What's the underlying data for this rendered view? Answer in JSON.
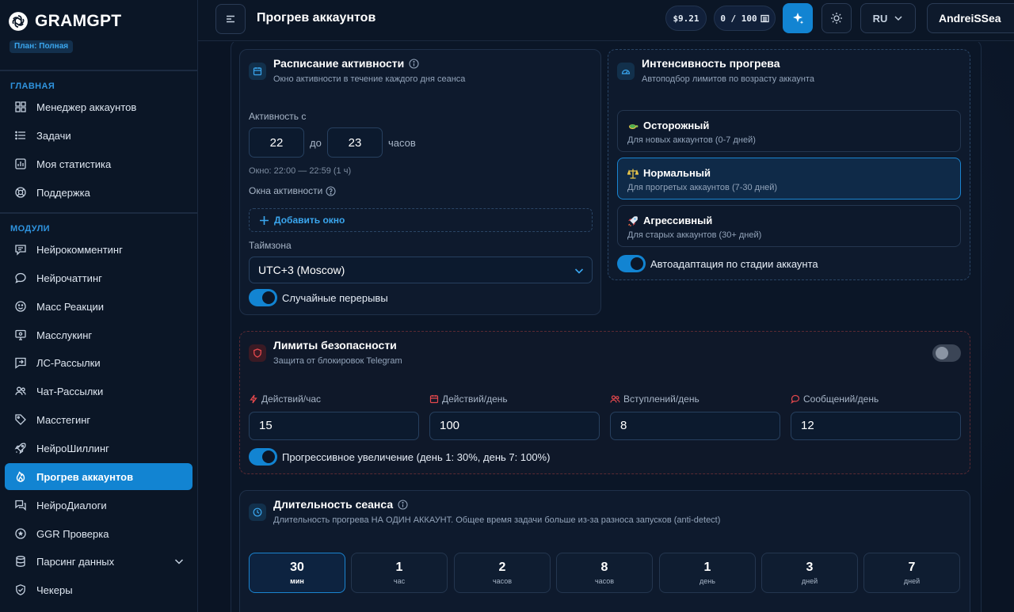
{
  "brand": {
    "name": "GRAMGPT",
    "plan": "План: Полная"
  },
  "sidebar": {
    "section_main": "ГЛАВНАЯ",
    "main_items": [
      {
        "label": "Менеджер аккаунтов",
        "icon": "grid-icon"
      },
      {
        "label": "Задачи",
        "icon": "list-icon"
      },
      {
        "label": "Моя статистика",
        "icon": "chart-icon"
      },
      {
        "label": "Поддержка",
        "icon": "lifebuoy-icon"
      }
    ],
    "section_modules": "МОДУЛИ",
    "module_items": [
      {
        "label": "Нейрокомментинг",
        "icon": "comment-lines-icon"
      },
      {
        "label": "Нейрочаттинг",
        "icon": "chat-bubble-icon"
      },
      {
        "label": "Масс Реакции",
        "icon": "smile-icon"
      },
      {
        "label": "Масслукинг",
        "icon": "monitor-icon"
      },
      {
        "label": "ЛС-Рассылки",
        "icon": "send-message-icon"
      },
      {
        "label": "Чат-Рассылки",
        "icon": "users-icon"
      },
      {
        "label": "Масстегинг",
        "icon": "tag-icon"
      },
      {
        "label": "НейроШиллинг",
        "icon": "rocket-icon"
      },
      {
        "label": "Прогрев аккаунтов",
        "icon": "flame-icon",
        "active": true
      },
      {
        "label": "НейроДиалоги",
        "icon": "dialogs-icon"
      },
      {
        "label": "GGR Проверка",
        "icon": "star-circle-icon"
      },
      {
        "label": "Парсинг данных",
        "icon": "database-icon"
      },
      {
        "label": "Чекеры",
        "icon": "shield-check-icon"
      }
    ]
  },
  "header": {
    "title": "Прогрев аккаунтов",
    "balance": "$9.21",
    "quota": "0 / 100",
    "language": "RU",
    "username": "AndreiSSea"
  },
  "schedule": {
    "title": "Расписание активности",
    "subtitle": "Окно активности в течение каждого дня сеанса",
    "activity_from_label": "Активность с",
    "from": "22",
    "to_label": "до",
    "to": "23",
    "hours_label": "часов",
    "window_hint": "Окно: 22:00 — 22:59 (1 ч)",
    "windows_label": "Окна активности",
    "add_window": "Добавить окно",
    "timezone_label": "Таймзона",
    "timezone": "UTC+3 (Moscow)",
    "random_breaks": "Случайные перерывы"
  },
  "intensity": {
    "title": "Интенсивность прогрева",
    "subtitle": "Автоподбор лимитов по возрасту аккаунта",
    "levels": [
      {
        "title": "Осторожный",
        "desc": "Для новых аккаунтов (0-7 дней)",
        "icon": "turtle-icon"
      },
      {
        "title": "Нормальный",
        "desc": "Для прогретых аккаунтов (7-30 дней)",
        "icon": "scales-icon",
        "active": true
      },
      {
        "title": "Агрессивный",
        "desc": "Для старых аккаунтов (30+ дней)",
        "icon": "rocket-icon"
      }
    ],
    "auto_adapt": "Автоадаптация по стадии аккаунта"
  },
  "limits": {
    "title": "Лимиты безопасности",
    "subtitle": "Защита от блокировок Telegram",
    "enabled": false,
    "fields": [
      {
        "label": "Действий/час",
        "value": "15",
        "icon": "bolt-icon"
      },
      {
        "label": "Действий/день",
        "value": "100",
        "icon": "calendar-icon"
      },
      {
        "label": "Вступлений/день",
        "value": "8",
        "icon": "users-icon"
      },
      {
        "label": "Сообщений/день",
        "value": "12",
        "icon": "chat-bubble-icon"
      }
    ],
    "progressive": "Прогрессивное увеличение (день 1: 30%, день 7: 100%)"
  },
  "duration": {
    "title": "Длительность сеанса",
    "subtitle": "Длительность прогрева НА ОДИН АККАУНТ. Общее время задачи больше из-за разноса запусков (anti-detect)",
    "options": [
      {
        "value": "30",
        "unit": "мин",
        "active": true
      },
      {
        "value": "1",
        "unit": "час"
      },
      {
        "value": "2",
        "unit": "часов"
      },
      {
        "value": "8",
        "unit": "часов"
      },
      {
        "value": "1",
        "unit": "день"
      },
      {
        "value": "3",
        "unit": "дней"
      },
      {
        "value": "7",
        "unit": "дней"
      }
    ]
  },
  "colors": {
    "accent": "#1284d2",
    "background": "#0a1424",
    "danger": "#e5484d"
  }
}
